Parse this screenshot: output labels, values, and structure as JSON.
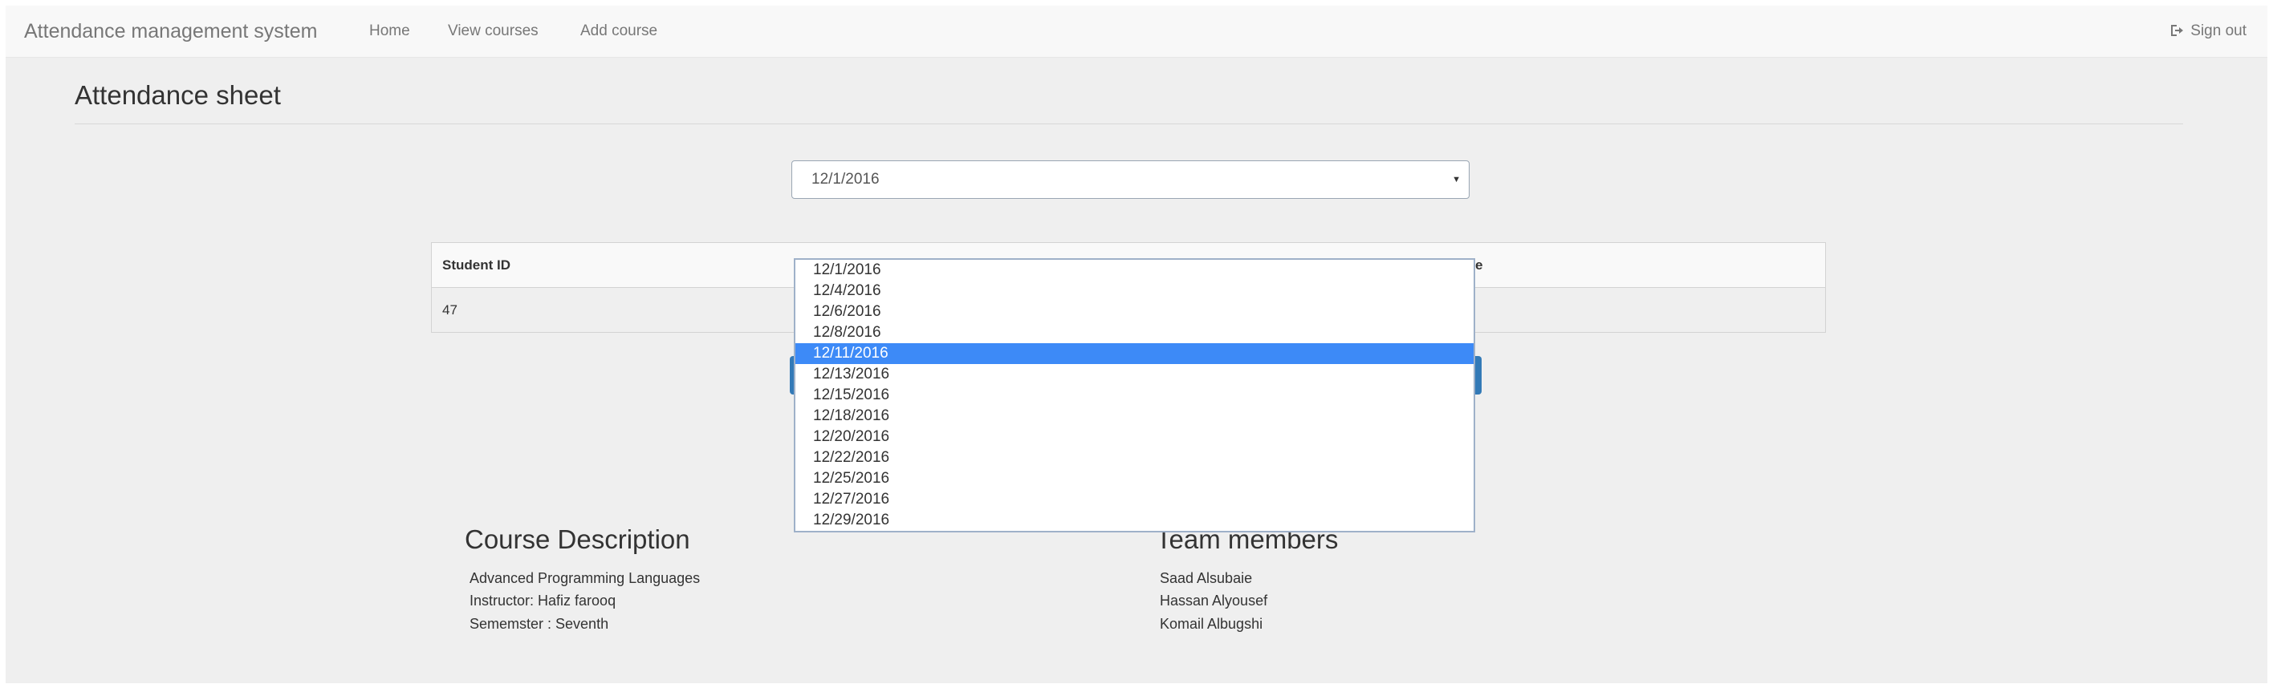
{
  "navbar": {
    "brand": "Attendance management system",
    "links": [
      "Home",
      "View courses",
      "Add course"
    ],
    "signout_label": "Sign out"
  },
  "page": {
    "title": "Attendance sheet"
  },
  "date_select": {
    "selected": "12/1/2016",
    "options": [
      "12/1/2016",
      "12/4/2016",
      "12/6/2016",
      "12/8/2016",
      "12/11/2016",
      "12/13/2016",
      "12/15/2016",
      "12/18/2016",
      "12/20/2016",
      "12/22/2016",
      "12/25/2016",
      "12/27/2016",
      "12/29/2016"
    ],
    "highlighted": "12/11/2016",
    "highlight_color": "#3d8af7"
  },
  "table": {
    "headers": [
      "Student ID",
      "e"
    ],
    "rows": [
      [
        "47"
      ]
    ]
  },
  "course": {
    "title": "Course Description",
    "lines": [
      "Advanced Programming Languages",
      "Instructor: Hafiz farooq",
      "Sememster : Seventh"
    ]
  },
  "team": {
    "title": "Team members",
    "members": [
      "Saad Alsubaie",
      "Hassan Alyousef",
      "Komail Albugshi"
    ]
  },
  "colors": {
    "primary_button": "#337ab7",
    "page_background": "#efefef",
    "navbar": "#f8f8f8"
  }
}
